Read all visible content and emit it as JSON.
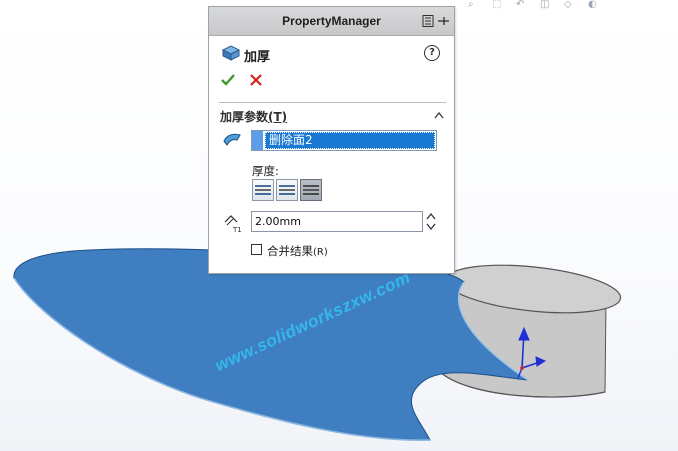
{
  "panel": {
    "title": "PropertyManager",
    "feature_name": "加厚",
    "help_icon": "help-icon",
    "ok_icon": "check-icon",
    "cancel_icon": "close-icon"
  },
  "params": {
    "group_title": "加厚参数",
    "group_shortcut": "(T)",
    "selected_face": "删除面2",
    "thickness_label": "厚度:",
    "thickness_options": [
      "side-1",
      "both-sides",
      "side-2"
    ],
    "thickness_active": "side-2",
    "distance_value": "2.00mm",
    "distance_icon_label": "T1",
    "merge_label": "合并结果",
    "merge_shortcut": "(R)",
    "merge_checked": false
  },
  "viewport": {
    "watermark": "www.solidworkszxw.com",
    "surface_color": "#3f7ec0",
    "cylinder_color": "#c9c9c9",
    "triad_color": "#1f2fd6"
  }
}
